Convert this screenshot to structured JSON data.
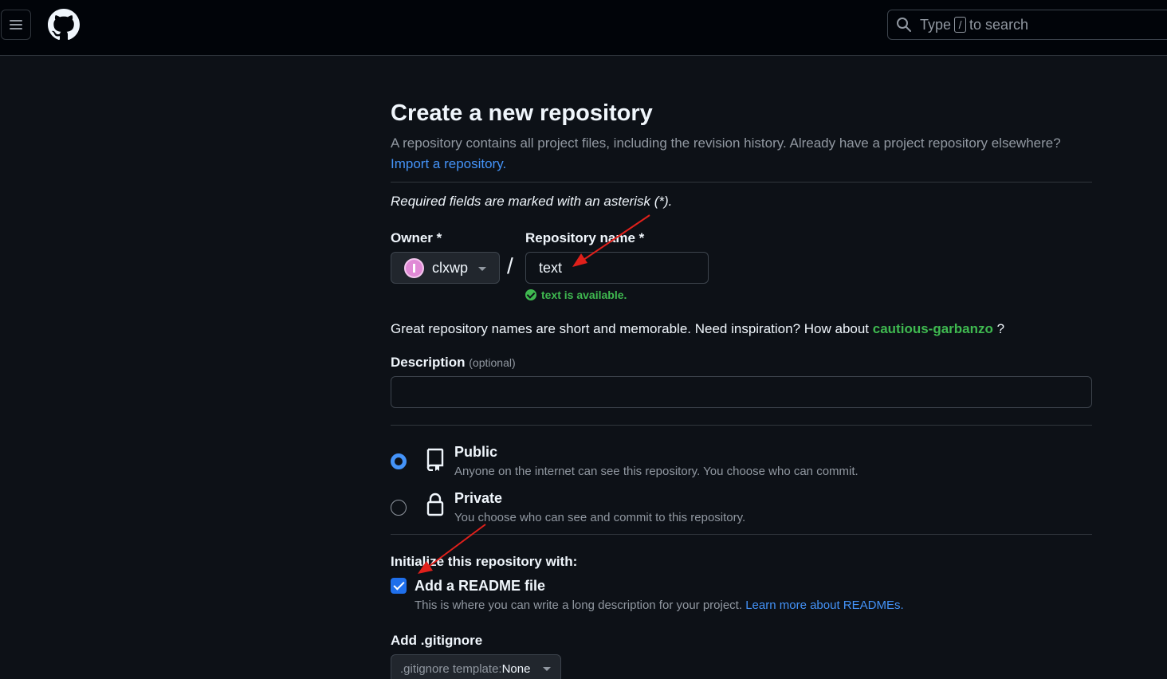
{
  "header": {
    "menu_icon": "hamburger-icon",
    "logo_icon": "github-logo",
    "search": {
      "prefix": "Type",
      "key": "/",
      "suffix": "to search"
    }
  },
  "page": {
    "title": "Create a new repository",
    "subtitle": "A repository contains all project files, including the revision history. Already have a project repository elsewhere?",
    "import_link": "Import a repository.",
    "required_note": "Required fields are marked with an asterisk (*).",
    "owner": {
      "label": "Owner *",
      "value": "clxwp"
    },
    "separator": "/",
    "repo_name": {
      "label": "Repository name *",
      "value": "text",
      "availability": "text is available."
    },
    "suggestion": {
      "prefix": "Great repository names are short and memorable. Need inspiration? How about",
      "name": "cautious-garbanzo",
      "suffix": "?"
    },
    "description": {
      "label": "Description",
      "optional": "(optional)",
      "value": ""
    },
    "visibility": {
      "selected": "public",
      "public": {
        "title": "Public",
        "desc": "Anyone on the internet can see this repository. You choose who can commit."
      },
      "private": {
        "title": "Private",
        "desc": "You choose who can see and commit to this repository."
      }
    },
    "initialize": {
      "heading": "Initialize this repository with:",
      "readme": {
        "checked": true,
        "label": "Add a README file",
        "desc": "This is where you can write a long description for your project.",
        "link": "Learn more about READMEs."
      }
    },
    "gitignore": {
      "label": "Add .gitignore",
      "template_prefix": ".gitignore template:",
      "template_value": "None"
    }
  },
  "colors": {
    "background": "#0d1117",
    "accent": "#4493f8",
    "success": "#3fb950",
    "annotation_arrow": "#e0201b"
  }
}
